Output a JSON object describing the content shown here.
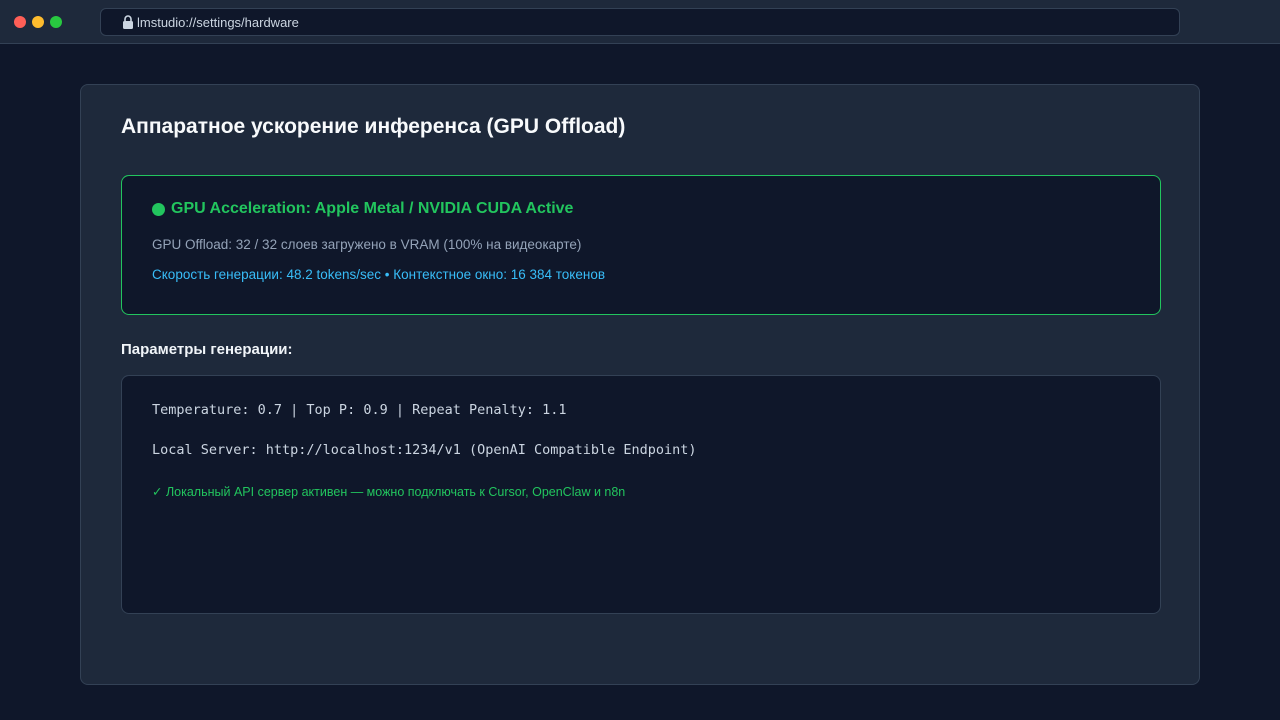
{
  "browser": {
    "url": "lmstudio://settings/hardware"
  },
  "panel": {
    "title": "Аппаратное ускорение инференса (GPU Offload)"
  },
  "status": {
    "headline": "GPU Acceleration: Apple Metal / NVIDIA CUDA Active",
    "offload_text": "GPU Offload: 32 / 32 слоев загружено в VRAM (100% на видеокарте)",
    "speed_text": "Скорость генерации: 48.2 tokens/sec • Контекстное окно: 16 384 токенов"
  },
  "params": {
    "title": "Параметры генерации:",
    "sampling_line": "Temperature: 0.7 | Top P: 0.9 | Repeat Penalty: 1.1",
    "server_line": "Local Server: http://localhost:1234/v1 (OpenAI Compatible Endpoint)",
    "api_status": "✓ Локальный API сервер активен — можно подключать к Cursor, OpenClaw и n8n"
  },
  "colors": {
    "background": "#0f172a",
    "panel": "#1e293b",
    "success": "#22c55e",
    "info": "#38bdf8"
  }
}
